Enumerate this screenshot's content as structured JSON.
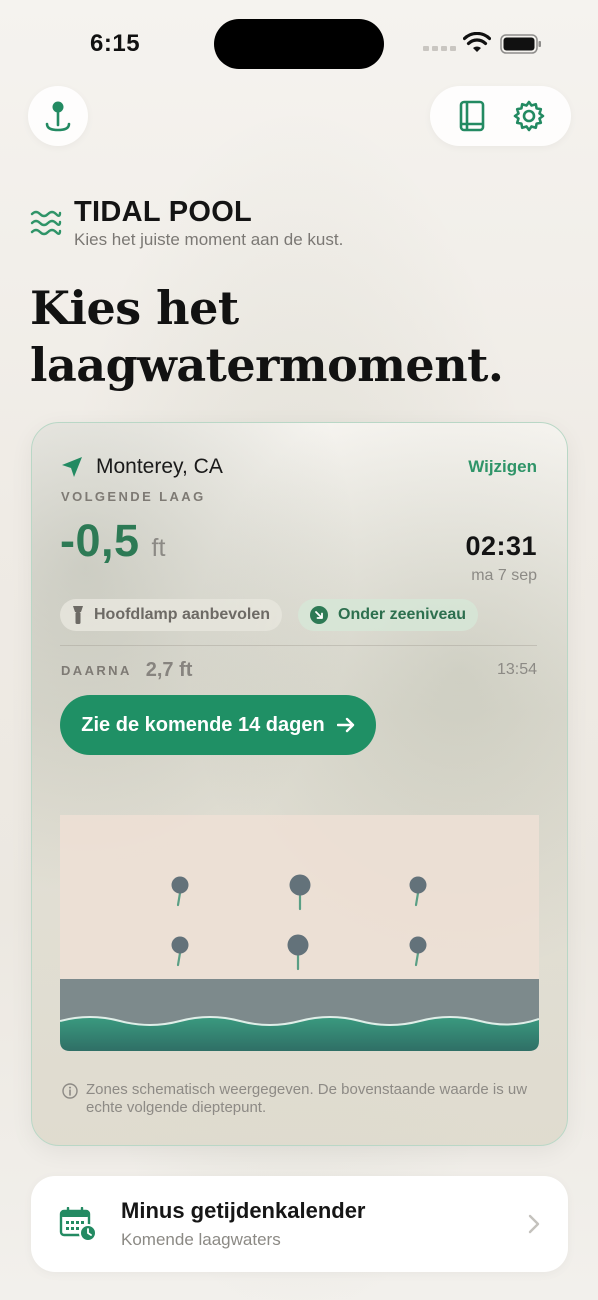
{
  "status_bar": {
    "time": "6:15"
  },
  "brand": {
    "title": "TIDAL POOL",
    "subtitle": "Kies het juiste moment aan de kust."
  },
  "headline": "Kies het laagwatermoment.",
  "card": {
    "location": "Monterey, CA",
    "change_label": "Wijzigen",
    "next_low_label": "VOLGENDE LAAG",
    "tide_value": "-0,5",
    "tide_unit": "ft",
    "tide_time": "02:31",
    "tide_date": "ma 7 sep",
    "chips": {
      "headlamp": "Hoofdlamp aanbevolen",
      "below_sea": "Onder zeeniveau"
    },
    "after": {
      "label": "DAARNA",
      "value": "2,7 ft",
      "time": "13:54"
    },
    "cta_label": "Zie de komende 14 dagen",
    "zones_note": "Zones schematisch weergegeven. De bovenstaande waarde is uw echte volgende dieptepunt."
  },
  "calendar_card": {
    "title": "Minus getijdenkalender",
    "subtitle": "Komende laagwaters"
  },
  "colors": {
    "accent_green": "#1f9065",
    "tide_green": "#2d7a55",
    "link_green": "#2f9468",
    "zone_sand": "#ede0d5",
    "zone_water": "#7d8a8c",
    "zone_sea": "#2f7e6b"
  },
  "icons": {
    "map": "map-pin-icon",
    "guide": "book-icon",
    "settings": "gear-icon",
    "brand": "waves-icon",
    "location": "location-arrow-icon",
    "headlamp": "flashlight-icon",
    "below_sea": "arrow-down-right-icon",
    "cta": "arrow-right-icon",
    "info": "info-icon",
    "calendar": "calendar-clock-icon",
    "chevron": "chevron-right-icon"
  }
}
